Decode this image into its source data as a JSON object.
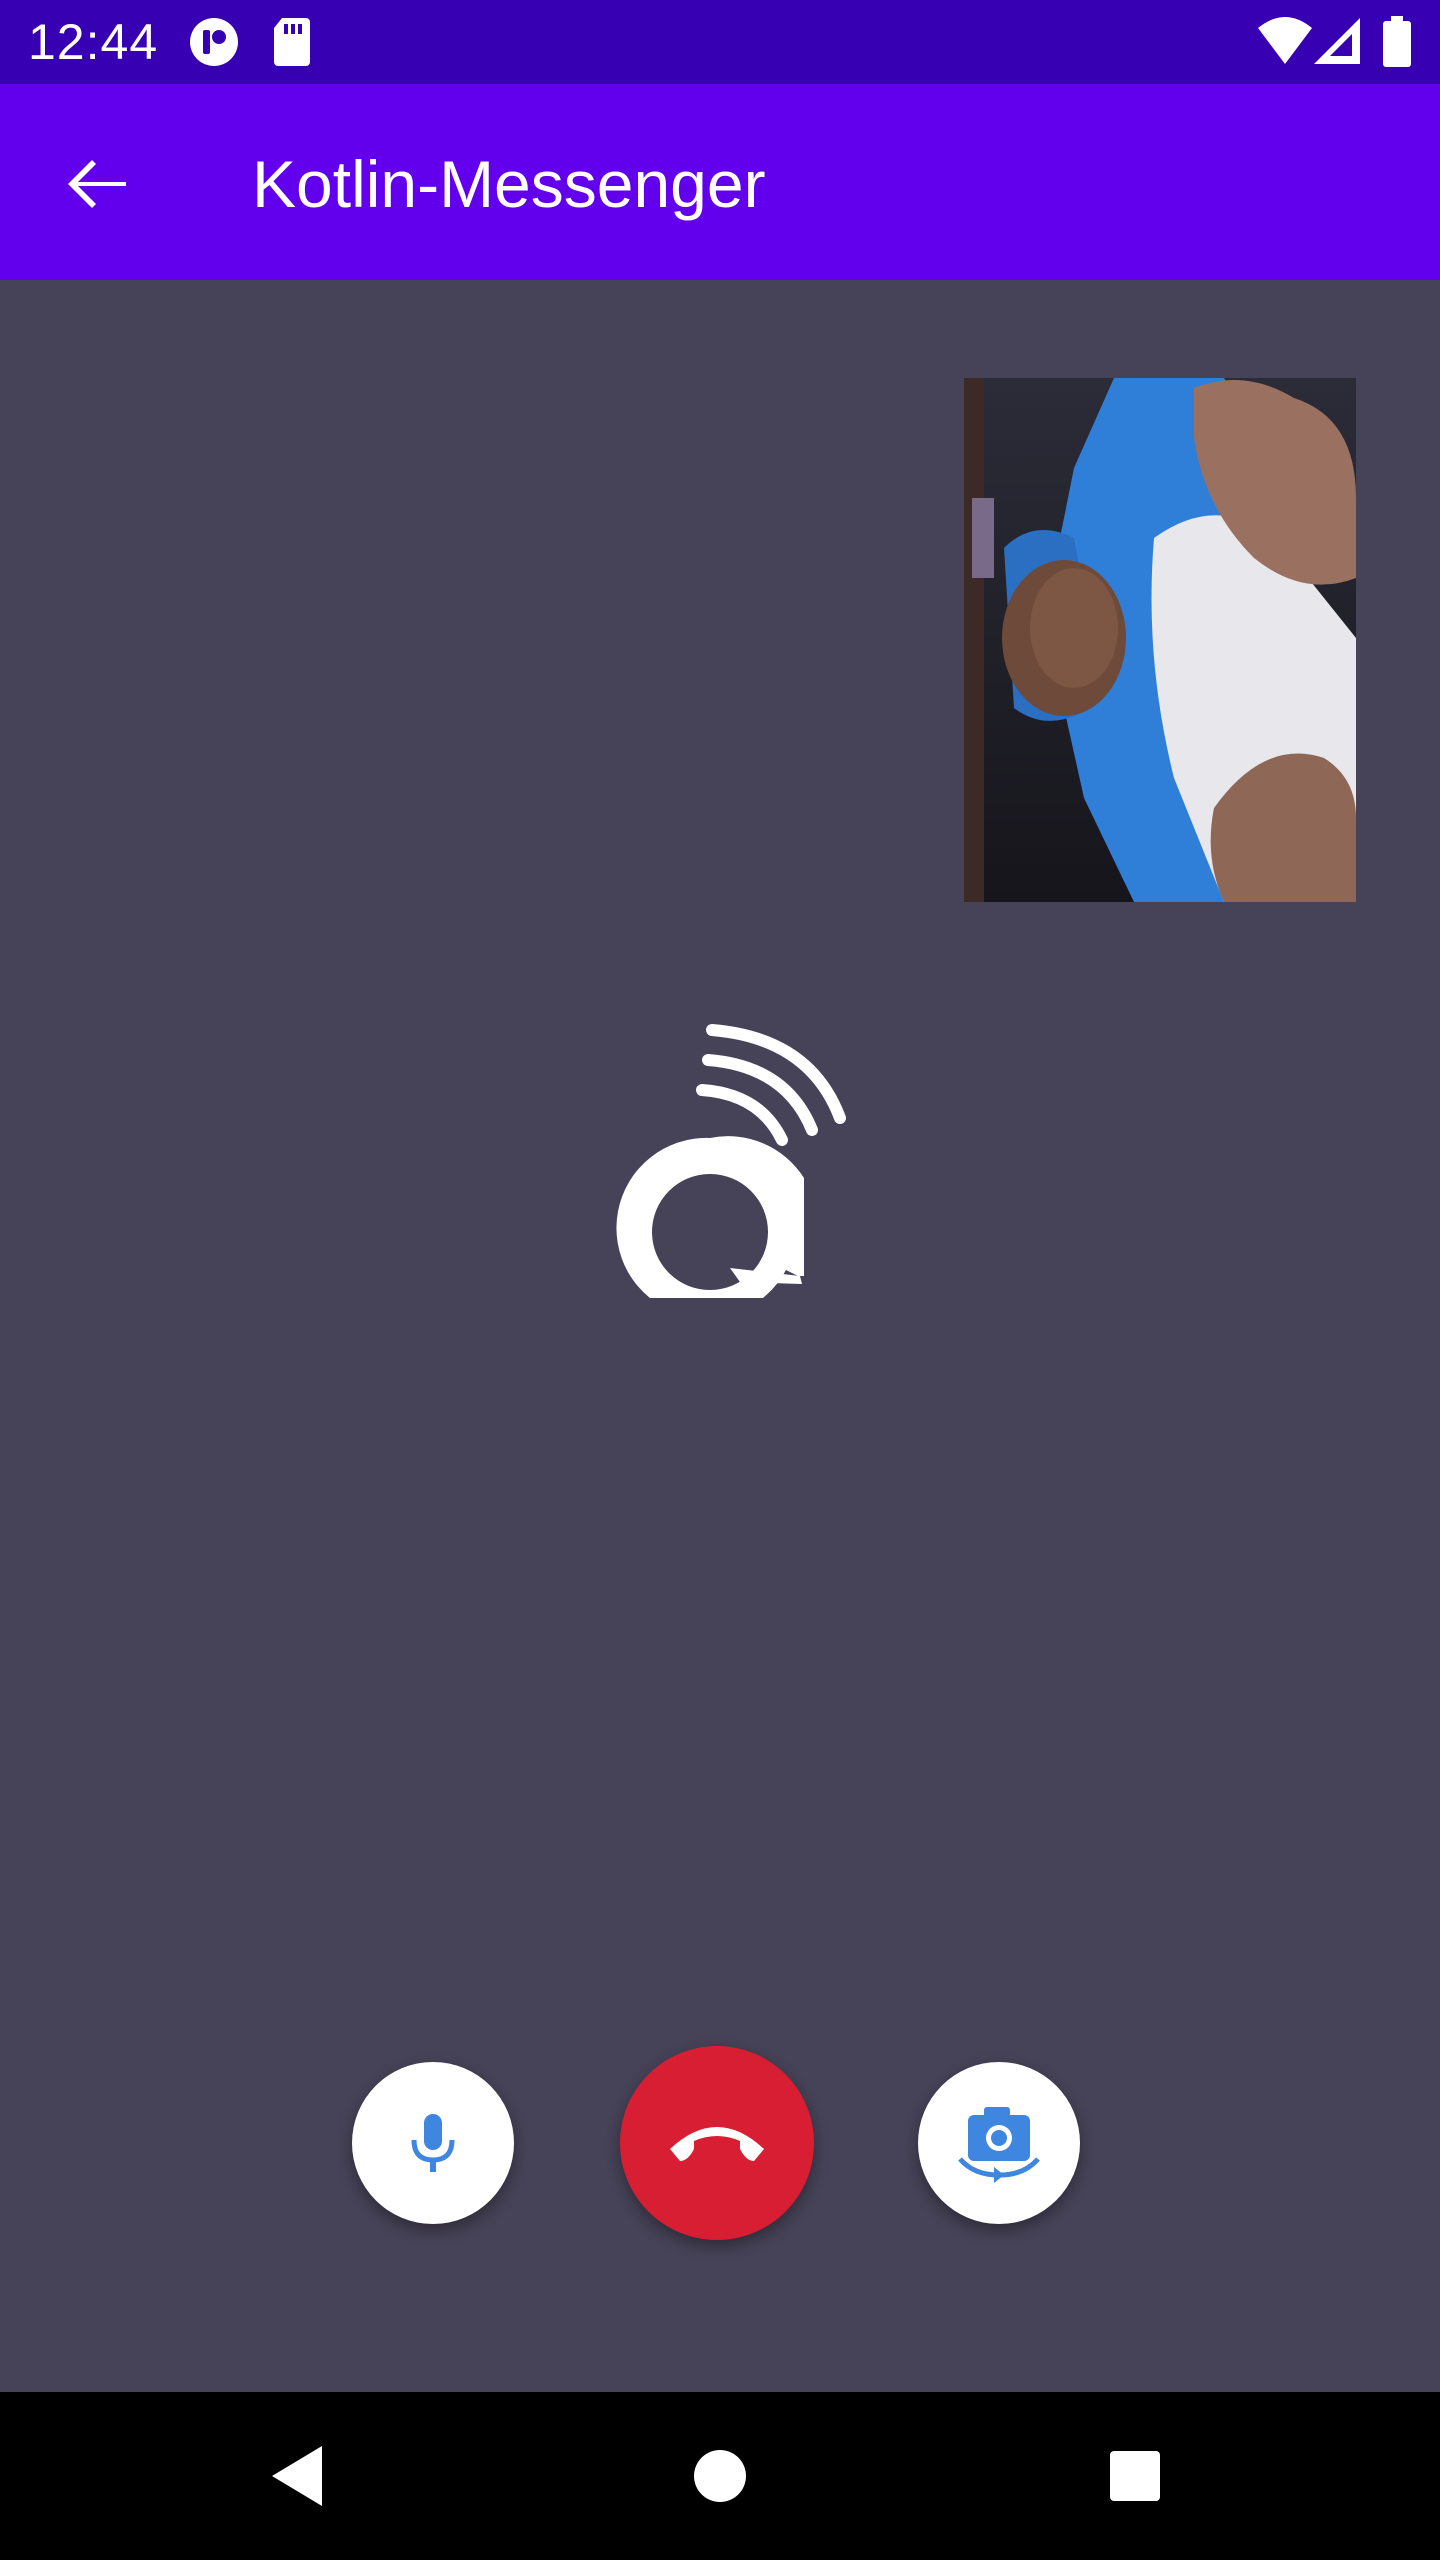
{
  "status_bar": {
    "time": "12:44"
  },
  "app_bar": {
    "title": "Kotlin-Messenger"
  },
  "colors": {
    "status_bar": "#3700B3",
    "app_bar": "#6200EE",
    "call_background": "#464257",
    "end_call": "#D81E32",
    "control_icon": "#3F86E0"
  },
  "icons": {
    "back": "arrow-back-icon",
    "mute": "microphone-icon",
    "end_call": "phone-hangup-icon",
    "switch_camera": "camera-switch-icon",
    "logo": "app-logo-icon"
  }
}
